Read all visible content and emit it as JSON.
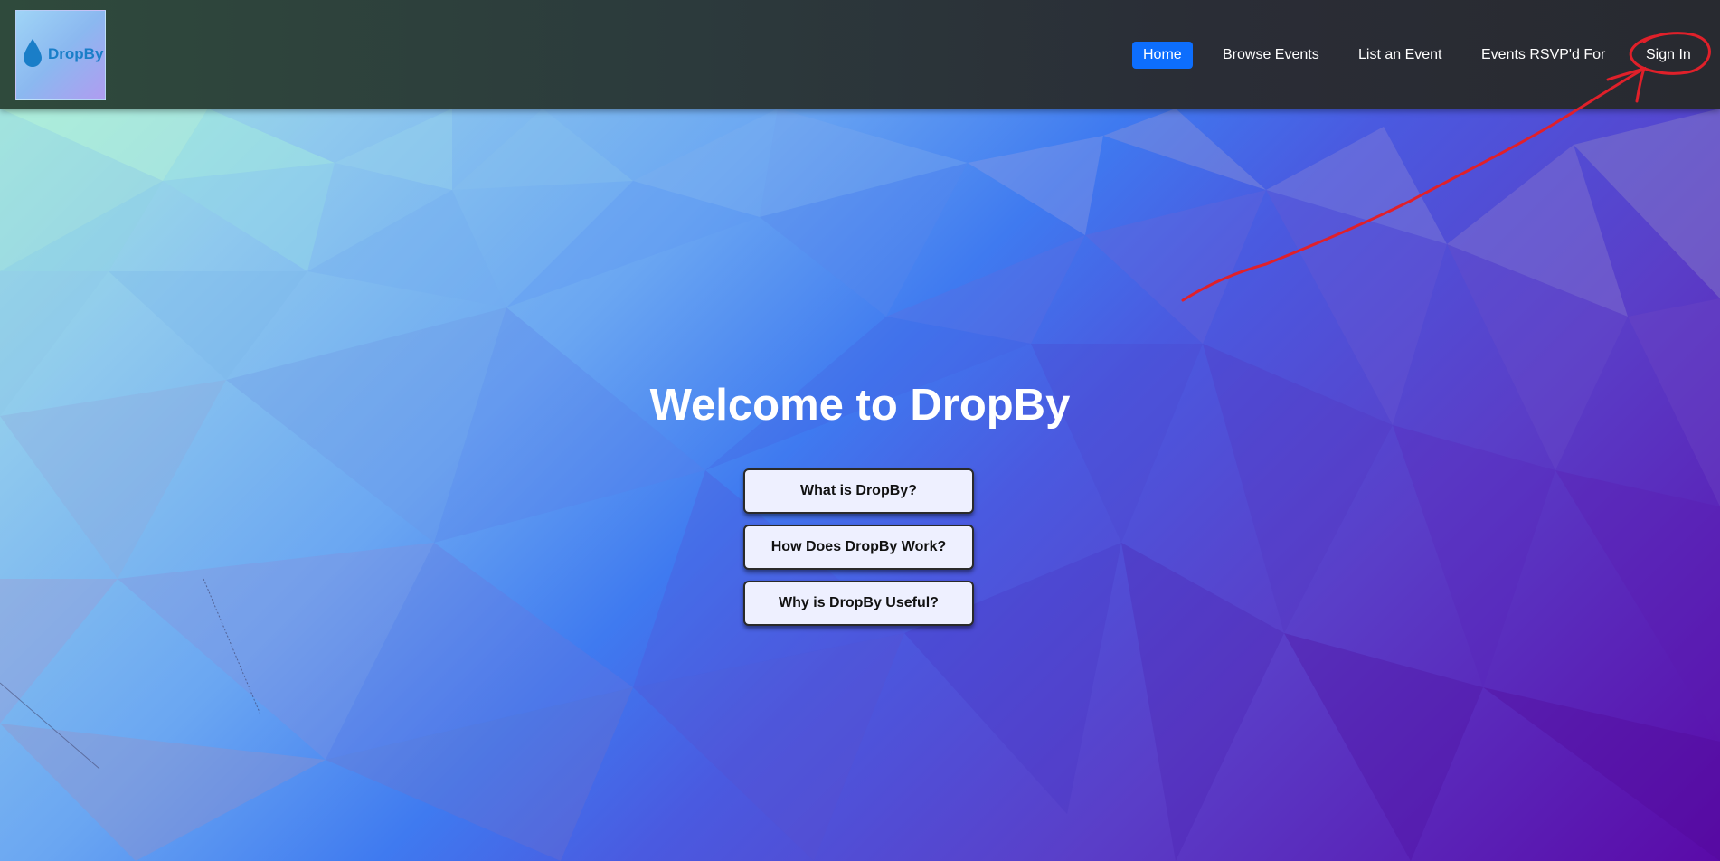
{
  "brand": {
    "logo_text": "DropBy",
    "logo_text_color": "#1a7ec8"
  },
  "nav": {
    "items": [
      {
        "label": "Home",
        "active": true
      },
      {
        "label": "Browse Events",
        "active": false
      },
      {
        "label": "List an Event",
        "active": false
      },
      {
        "label": "Events RSVP'd For",
        "active": false
      },
      {
        "label": "Sign In",
        "active": false
      }
    ],
    "active_color": "#0d6efd"
  },
  "hero": {
    "title": "Welcome to DropBy",
    "buttons": [
      {
        "label": "What is DropBy?"
      },
      {
        "label": "How Does DropBy Work?"
      },
      {
        "label": "Why is DropBy Useful?"
      }
    ]
  },
  "annotation": {
    "color": "#e0202a",
    "marks": [
      "circle-around-sign-in",
      "arrow-to-sign-in"
    ]
  }
}
